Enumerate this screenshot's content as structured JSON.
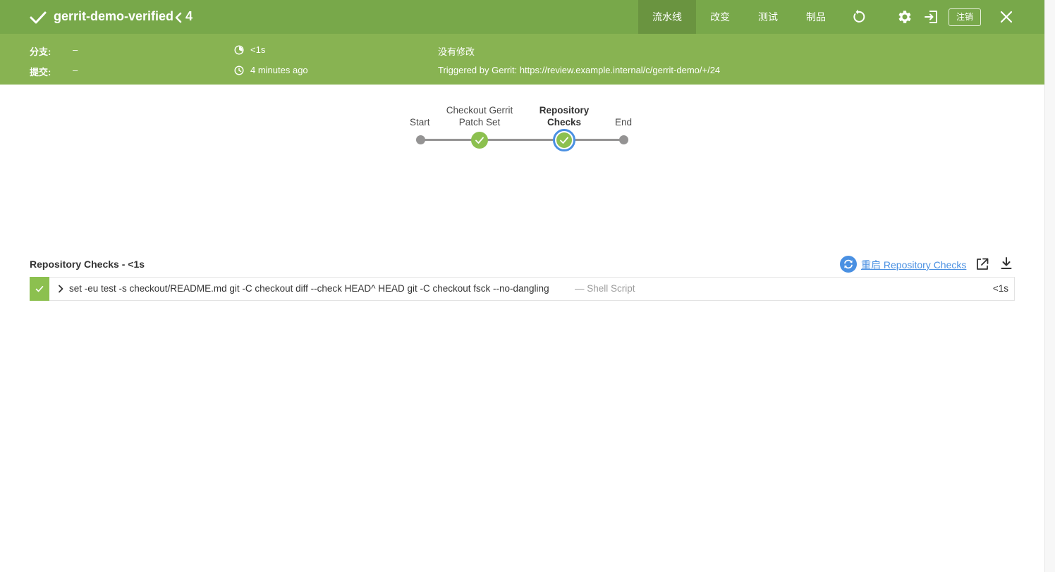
{
  "header": {
    "title": "gerrit-demo-verified",
    "run_number": "4",
    "tabs": [
      {
        "label": "流水线",
        "active": true
      },
      {
        "label": "改变",
        "active": false
      },
      {
        "label": "测试",
        "active": false
      },
      {
        "label": "制品",
        "active": false
      }
    ],
    "logout_label": "注销",
    "icons": [
      "checkmark-icon",
      "chevron-left-icon",
      "rerun-icon",
      "gear-icon",
      "exit-icon",
      "close-icon"
    ]
  },
  "summary": {
    "branch_label": "分支:",
    "branch_value": "–",
    "commit_label": "提交:",
    "commit_value": "–",
    "duration": "<1s",
    "started": "4 minutes ago",
    "changes": "没有修改",
    "cause": "Triggered by Gerrit: https://review.example.internal/c/gerrit-demo/+/24"
  },
  "pipeline": {
    "stages": [
      {
        "name": "Start",
        "status": "none"
      },
      {
        "name_line1": "Checkout Gerrit",
        "name_line2": "Patch Set",
        "status": "success"
      },
      {
        "name_line1": "Repository",
        "name_line2": "Checks",
        "status": "success",
        "selected": true
      },
      {
        "name": "End",
        "status": "none"
      }
    ]
  },
  "step_detail": {
    "title": "Repository Checks - <1s",
    "restart_label": "重启 Repository Checks",
    "steps": [
      {
        "command": "set -eu test -s checkout/README.md git -C checkout diff --check HEAD^ HEAD git -C checkout fsck --no-dangling",
        "kind": "— Shell Script",
        "duration": "<1s",
        "status": "success"
      }
    ]
  },
  "colors": {
    "header_bg": "#78a84a",
    "summary_bg": "#88b352",
    "active_tab_bg": "#6a9440",
    "success": "#8cc04f",
    "selected_ring": "#4a90e2",
    "link": "#4a90e2"
  }
}
